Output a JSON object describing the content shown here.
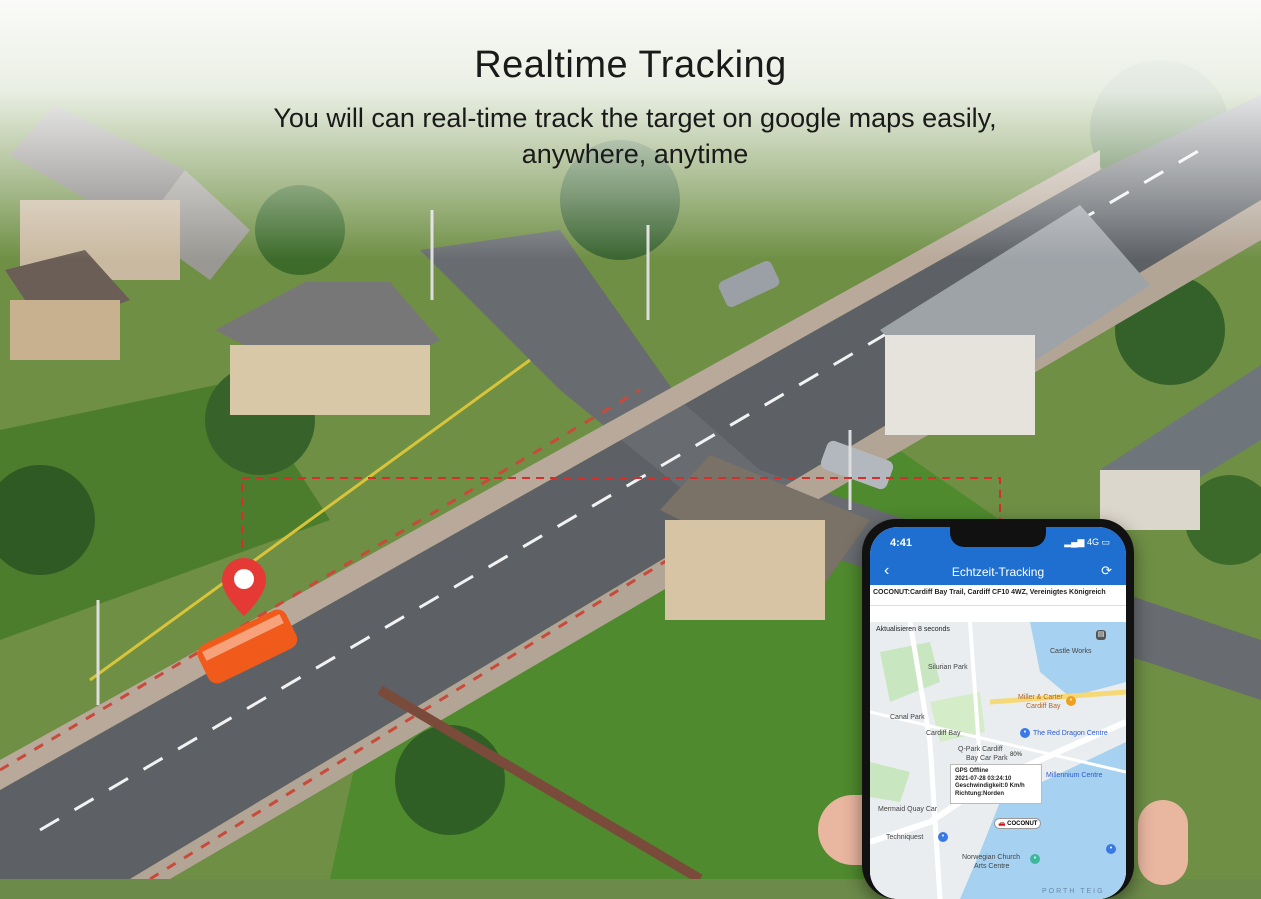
{
  "header": {
    "title": "Realtime Tracking",
    "subtitle": "You will can real-time track the target on google maps easily, anywhere, anytime"
  },
  "phone": {
    "status_time": "4:41",
    "status_network": "4G",
    "nav_title": "Echtzeit-Tracking",
    "address": "COCONUT:Cardiff Bay Trail, Cardiff CF10 4WZ, Vereinigtes Königreich",
    "refresh_note": "Aktualisieren 8 seconds",
    "battery": "80%",
    "info_box": {
      "line1": "GPS Offline",
      "line2": "2021-07-28 03:24:10",
      "line3": "Geschwindigkeit:0 Km/h",
      "line4": "Richtung:Norden"
    },
    "vehicle_label": "COCONUT",
    "map_labels": {
      "castle_works": "Castle Works",
      "silurian_park": "Silurian Park",
      "miller_carter": "Miller & Carter",
      "cardiff_bay_poi": "Cardiff Bay",
      "canal_park": "Canal Park",
      "cardiff_bay_station": "Cardiff Bay",
      "red_dragon": "The Red Dragon Centre",
      "q_park": "Q-Park Cardiff",
      "bay_car_park": "Bay Car Park",
      "millennium": "Millennium Centre",
      "mermaid_quay": "Mermaid Quay Car",
      "techniquest": "Techniquest",
      "norwegian_church": "Norwegian Church",
      "arts_centre": "Arts Centre",
      "porth_teigr": "PORTH TEIG"
    }
  },
  "colors": {
    "app_blue": "#1e6fd0",
    "pin_red": "#e53935",
    "vehicle": "#f05a1a"
  }
}
